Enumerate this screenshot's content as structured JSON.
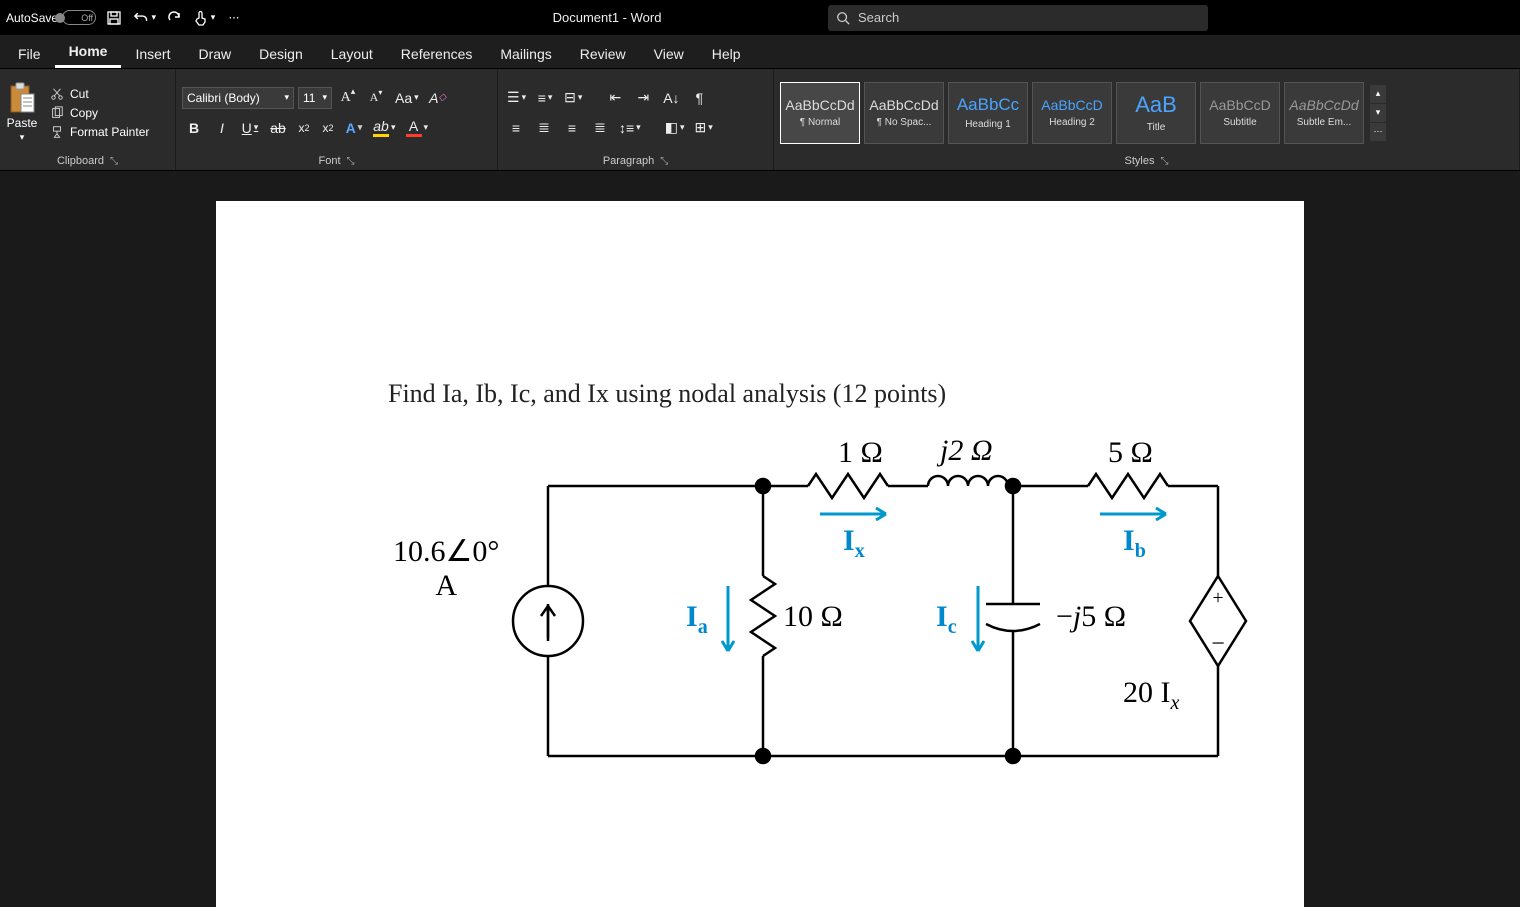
{
  "titlebar": {
    "autosave_label": "AutoSave",
    "autosave_state": "Off",
    "doc_title": "Document1  -  Word",
    "search_placeholder": "Search"
  },
  "tabs": [
    "File",
    "Home",
    "Insert",
    "Draw",
    "Design",
    "Layout",
    "References",
    "Mailings",
    "Review",
    "View",
    "Help"
  ],
  "active_tab": "Home",
  "clipboard": {
    "paste": "Paste",
    "cut": "Cut",
    "copy": "Copy",
    "format_painter": "Format Painter",
    "group_label": "Clipboard"
  },
  "font": {
    "name": "Calibri (Body)",
    "size": "11",
    "group_label": "Font"
  },
  "paragraph": {
    "group_label": "Paragraph"
  },
  "styles": {
    "group_label": "Styles",
    "items": [
      {
        "preview": "AaBbCcDd",
        "name": "¶ Normal",
        "cls": ""
      },
      {
        "preview": "AaBbCcDd",
        "name": "¶ No Spac...",
        "cls": ""
      },
      {
        "preview": "AaBbCc",
        "name": "Heading 1",
        "cls": "blue"
      },
      {
        "preview": "AaBbCcD",
        "name": "Heading 2",
        "cls": "blue"
      },
      {
        "preview": "AaB",
        "name": "Title",
        "cls": "big"
      },
      {
        "preview": "AaBbCcD",
        "name": "Subtitle",
        "cls": ""
      },
      {
        "preview": "AaBbCcDd",
        "name": "Subtle Em...",
        "cls": "em"
      }
    ]
  },
  "document": {
    "problem_text": "Find Ia, Ib, Ic, and Ix using nodal analysis  (12 points)",
    "labels": {
      "src": "10.6∠0°",
      "src_unit": "A",
      "r1": "1 Ω",
      "l1": "j2 Ω",
      "r5": "5 Ω",
      "r10": "10 Ω",
      "cap": "−j5 Ω",
      "vdep": "20 I",
      "vdep_sub": "x",
      "Ia": "I",
      "Ia_sub": "a",
      "Ib": "I",
      "Ib_sub": "b",
      "Ic": "I",
      "Ic_sub": "c",
      "Ix": "I",
      "Ix_sub": "x"
    }
  }
}
